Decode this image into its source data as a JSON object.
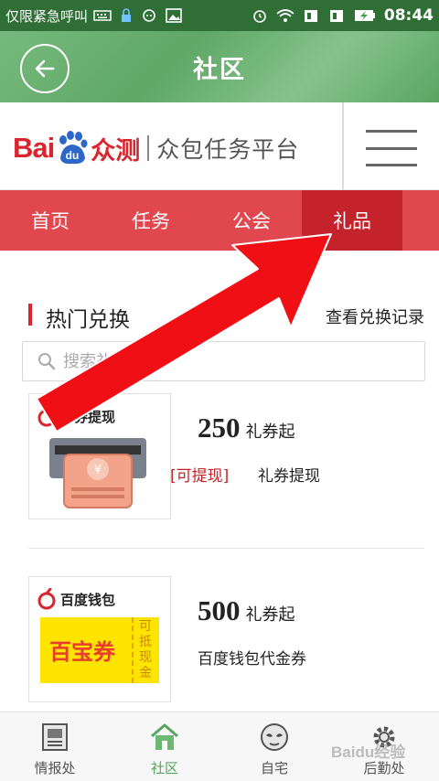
{
  "status_bar": {
    "left_text": "仅限紧急呼叫",
    "time": "08:44"
  },
  "header": {
    "title": "社区"
  },
  "brand": {
    "name_latin": "Bai",
    "name_du": "du",
    "name_cn": "众测",
    "slogan": "众包任务平台",
    "primary_color": "#d9262e"
  },
  "tabs": [
    {
      "label": "首页",
      "active": false
    },
    {
      "label": "任务",
      "active": false
    },
    {
      "label": "公会",
      "active": false
    },
    {
      "label": "礼品",
      "active": true
    }
  ],
  "section": {
    "title": "热门兑换",
    "record_link": "查看兑换记录"
  },
  "search": {
    "placeholder": "搜索礼品名称"
  },
  "gifts": [
    {
      "image_caption": "礼券提现",
      "price": "250",
      "price_unit": "礼券起",
      "tag": "[可提现]",
      "name": "礼券提现"
    },
    {
      "image_caption": "百度钱包",
      "image_ticket_text": "百宝券",
      "image_ticket_side": "可抵现金",
      "price": "500",
      "price_unit": "礼券起",
      "tag": "",
      "name": "百度钱包代金券"
    }
  ],
  "bottom_nav": [
    {
      "label": "情报处",
      "icon": "newspaper-icon",
      "active": false
    },
    {
      "label": "社区",
      "icon": "home-icon",
      "active": true
    },
    {
      "label": "自宅",
      "icon": "mask-icon",
      "active": false
    },
    {
      "label": "后勤处",
      "icon": "gear-icon",
      "active": false
    }
  ],
  "watermark": "Baidu经验",
  "theme": {
    "header_green": "#5fa866",
    "tab_red": "#e0474e",
    "tab_active_red": "#c4232b"
  }
}
